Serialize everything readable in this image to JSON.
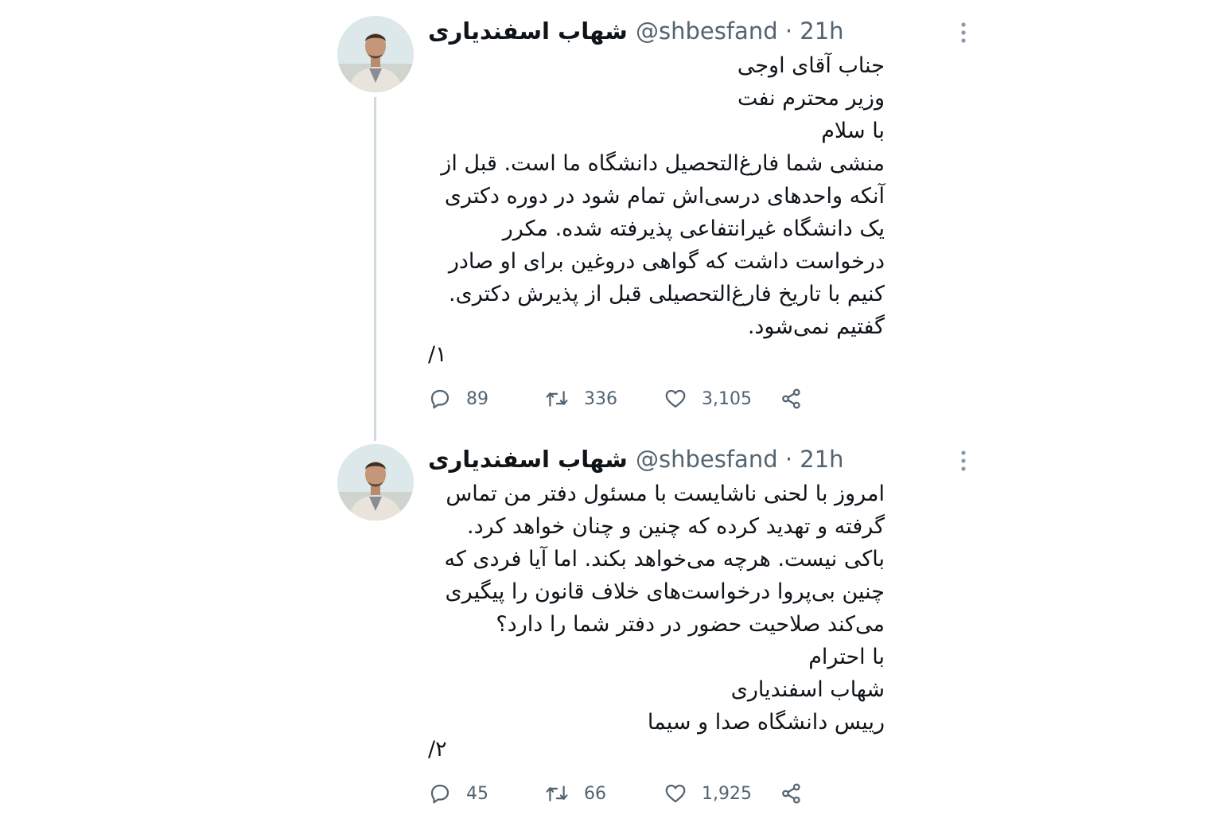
{
  "tweets": [
    {
      "author_name": "شهاب اسفندیاری",
      "handle_time": "@shbesfand · 21h",
      "body_lines": [
        "جناب آقای اوجی",
        "وزیر محترم نفت",
        "با سلام",
        "منشی شما فارغ‌التحصیل دانشگاه ما است. قبل از",
        "آنکه واحدهای درسی‌اش تمام شود در دوره دکتری",
        "یک دانشگاه غیرانتفاعی پذیرفته شده. مکرر",
        "درخواست داشت که گواهی دروغین برای او صادر",
        "کنیم با تاریخ فارغ‌التحصیلی قبل از پذیرش دکتری.",
        "گفتیم نمی‌شود."
      ],
      "thread_counter": "۱/",
      "replies": "89",
      "retweets": "336",
      "likes": "3,105"
    },
    {
      "author_name": "شهاب اسفندیاری",
      "handle_time": "@shbesfand · 21h",
      "body_lines": [
        "امروز با لحنی ناشایست با مسئول دفتر من تماس",
        "گرفته و تهدید کرده که چنین و چنان خواهد کرد.",
        "باکی نیست. هرچه می‌خواهد بکند. اما آیا فردی که",
        "چنین بی‌پروا درخواست‌های خلاف قانون را پیگیری",
        "می‌کند صلاحیت حضور در دفتر شما را دارد؟",
        "با احترام",
        "شهاب اسفندیاری",
        "رییس دانشگاه صدا و سیما"
      ],
      "thread_counter": "۲/",
      "replies": "45",
      "retweets": "66",
      "likes": "1,925"
    }
  ],
  "icons": {
    "reply": "reply-icon",
    "retweet": "retweet-icon",
    "like": "heart-icon",
    "share": "share-icon",
    "more": "more-vertical-icon"
  },
  "colors": {
    "text": "#0f1419",
    "secondary": "#536471",
    "thread_line": "#cfd9de"
  }
}
